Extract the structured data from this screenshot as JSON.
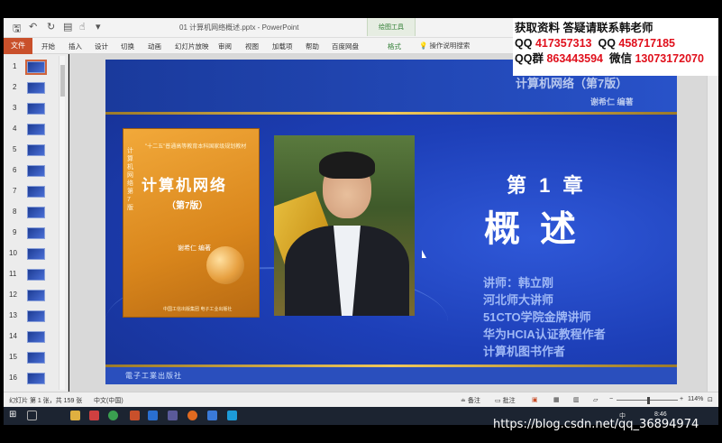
{
  "window": {
    "doc_title": "01 计算机网络概述.pptx - PowerPoint",
    "drawing_tools_tab": "绘图工具"
  },
  "ribbon": {
    "file": "文件",
    "tabs": [
      "开始",
      "插入",
      "设计",
      "切换",
      "动画",
      "幻灯片放映",
      "审阅",
      "视图",
      "加载项",
      "帮助",
      "百度网盘"
    ],
    "format_tab": "格式",
    "tell_me": "操作说明搜索"
  },
  "contact": {
    "line1": "获取资料 答疑请联系韩老师",
    "qq_label1": "QQ",
    "qq1": "417357313",
    "qq_label2": "QQ",
    "qq2": "458717185",
    "qqgroup_label": "QQ群",
    "qqgroup": "863443594",
    "wechat_label": "微信",
    "wechat": "13073172070"
  },
  "thumbnails": [
    "1",
    "2",
    "3",
    "4",
    "5",
    "6",
    "7",
    "8",
    "9",
    "10",
    "11",
    "12",
    "13",
    "14",
    "15",
    "16"
  ],
  "slide": {
    "book_title_overlay": "计算机网络（第7版）",
    "author_overlay": "谢希仁  编著",
    "book": {
      "series": "\"十二五\"普通高等教育本科国家级规划教材",
      "title": "计算机网络",
      "edition": "（第7版）",
      "author": "谢希仁  编著",
      "spine": "计算机网络 第7版",
      "publisher": "中国工信出版集团 电子工业出版社"
    },
    "chapter_label": "第 1 章",
    "chapter_title": "概述",
    "lecturer_lines": [
      "讲师：韩立刚",
      "河北师大讲师",
      "51CTO学院金牌讲师",
      "华为HCIA认证教程作者",
      "计算机图书作者"
    ],
    "publisher_footer": "電子工業出版社"
  },
  "statusbar": {
    "slide_info": "幻灯片 第 1 张，共 159 张",
    "language": "中文(中国)",
    "notes": "备注",
    "comments": "批注",
    "zoom": "114%"
  },
  "taskbar": {
    "ime": "中",
    "clock": "8:46"
  },
  "watermark": "https://blog.csdn.net/qq_36894974"
}
